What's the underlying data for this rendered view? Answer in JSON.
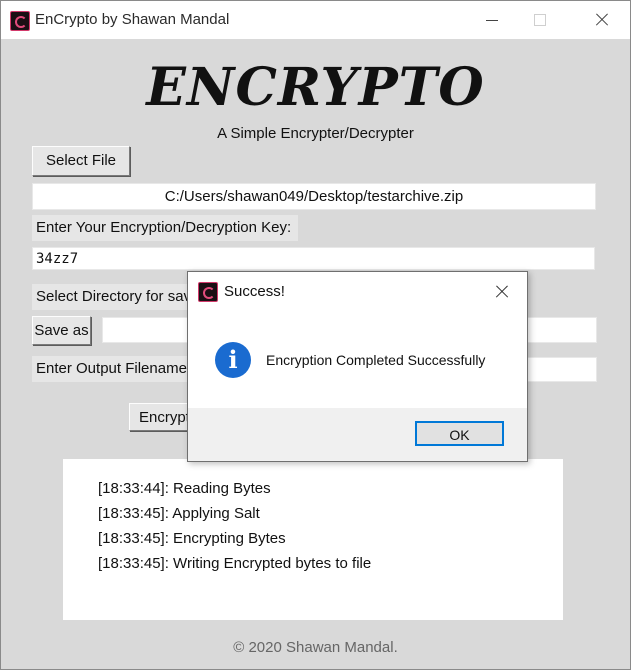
{
  "window": {
    "title": "EnCrypto by Shawan Mandal",
    "controls": {
      "minimize": "minimize",
      "maximize": "maximize",
      "close": "close"
    }
  },
  "header": {
    "logo": "ENCRYPTO",
    "subtitle": "A Simple Encrypter/Decrypter"
  },
  "form": {
    "select_file_label": "Select File",
    "file_path": "C:/Users/shawan049/Desktop/testarchive.zip",
    "key_label": "Enter Your Encryption/Decryption Key:",
    "key_value": "34zz7",
    "dir_label": "Select Directory for sav",
    "save_as_label": "Save as",
    "save_dir_value": "",
    "output_label": "Enter Output Filename",
    "output_value": "",
    "encrypt_label": "Encrypt"
  },
  "log": {
    "lines": [
      "[18:33:44]: Reading Bytes",
      "[18:33:45]: Applying Salt",
      "[18:33:45]: Encrypting Bytes",
      "[18:33:45]: Writing Encrypted bytes to file"
    ]
  },
  "footer": {
    "text": "© 2020 Shawan Mandal."
  },
  "dialog": {
    "title": "Success!",
    "message": "Encryption Completed Successfully",
    "ok_label": "OK",
    "icon": "info-icon",
    "icon_glyph": "i"
  },
  "colors": {
    "accent": "#0078d7",
    "info": "#1a6bd0",
    "app_icon": "#d23a6b"
  }
}
